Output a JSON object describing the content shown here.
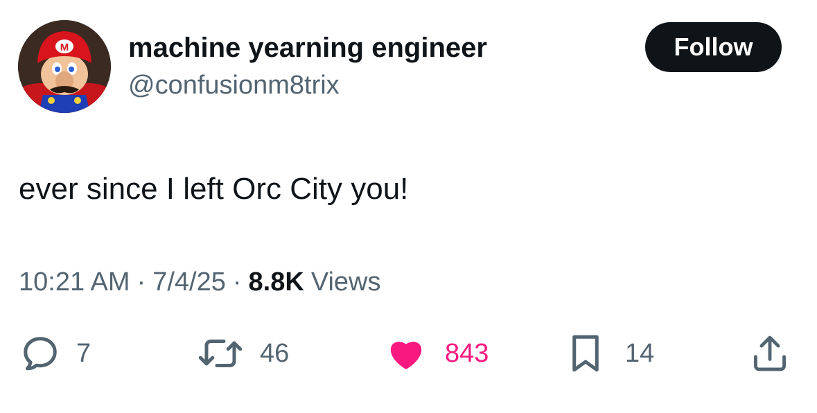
{
  "user": {
    "display_name": "machine yearning engineer",
    "handle": "@confusionm8trix"
  },
  "follow_label": "Follow",
  "tweet": {
    "text": "ever since I left Orc City you!"
  },
  "meta": {
    "time": "10:21 AM",
    "separator": "·",
    "date": "7/4/25",
    "views_count": "8.8K",
    "views_label": "Views"
  },
  "actions": {
    "replies": "7",
    "reposts": "46",
    "likes": "843",
    "bookmarks": "14"
  },
  "colors": {
    "text": "#0f1419",
    "secondary": "#536471",
    "like": "#f91880",
    "button_bg": "#0f1419"
  },
  "icons": {
    "reply": "speech-bubble-icon",
    "repost": "repost-arrows-icon",
    "like": "heart-icon",
    "bookmark": "bookmark-icon",
    "share": "share-upload-icon"
  }
}
